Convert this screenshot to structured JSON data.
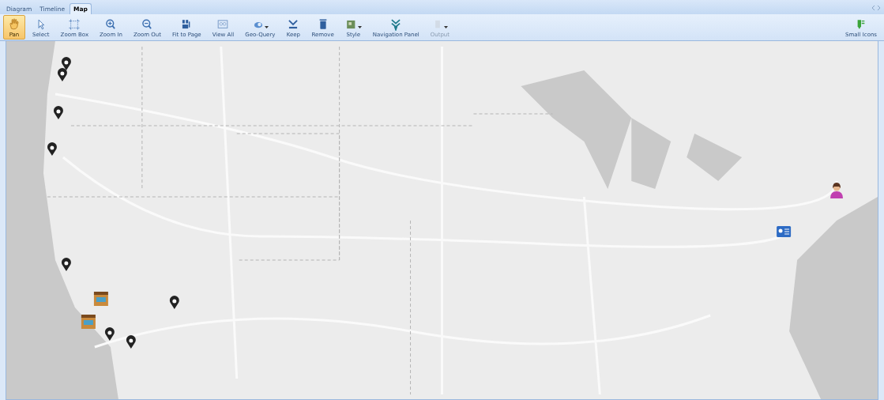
{
  "tabs": [
    {
      "label": "Diagram",
      "selected": false
    },
    {
      "label": "Timeline",
      "selected": false
    },
    {
      "label": "Map",
      "selected": true
    }
  ],
  "toolbar": {
    "buttons": [
      {
        "label": "Pan",
        "selected": true,
        "dropdown": false,
        "disabled": false
      },
      {
        "label": "Select",
        "selected": false,
        "dropdown": false,
        "disabled": false
      },
      {
        "label": "Zoom Box",
        "selected": false,
        "dropdown": false,
        "disabled": false
      },
      {
        "label": "Zoom In",
        "selected": false,
        "dropdown": false,
        "disabled": false
      },
      {
        "label": "Zoom Out",
        "selected": false,
        "dropdown": false,
        "disabled": false
      },
      {
        "label": "Fit to Page",
        "selected": false,
        "dropdown": false,
        "disabled": false
      },
      {
        "label": "View All",
        "selected": false,
        "dropdown": false,
        "disabled": false
      },
      {
        "label": "Geo-Query",
        "selected": false,
        "dropdown": true,
        "disabled": false
      },
      {
        "label": "Keep",
        "selected": false,
        "dropdown": false,
        "disabled": false
      },
      {
        "label": "Remove",
        "selected": false,
        "dropdown": false,
        "disabled": false
      },
      {
        "label": "Style",
        "selected": false,
        "dropdown": true,
        "disabled": false
      },
      {
        "label": "Navigation Panel",
        "selected": false,
        "dropdown": false,
        "disabled": false
      },
      {
        "label": "Output",
        "selected": false,
        "dropdown": true,
        "disabled": true
      }
    ],
    "right_button": {
      "label": "Small Icons"
    }
  },
  "map": {
    "markers": [
      {
        "kind": "pin"
      },
      {
        "kind": "pin"
      },
      {
        "kind": "pin"
      },
      {
        "kind": "pin"
      },
      {
        "kind": "pin"
      },
      {
        "kind": "pin"
      },
      {
        "kind": "pin"
      },
      {
        "kind": "pin"
      },
      {
        "kind": "building"
      },
      {
        "kind": "building"
      },
      {
        "kind": "person"
      },
      {
        "kind": "card"
      }
    ]
  }
}
